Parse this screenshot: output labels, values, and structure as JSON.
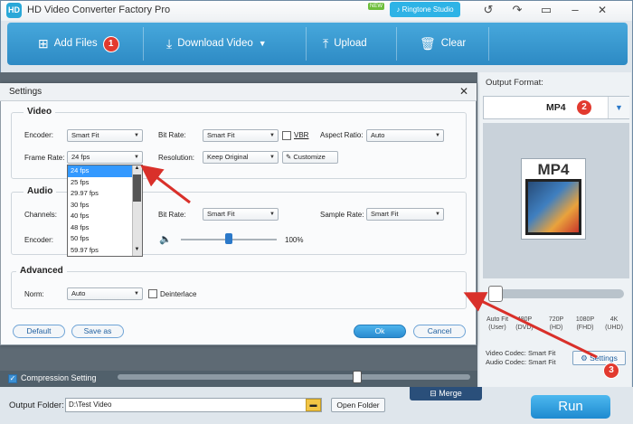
{
  "app": {
    "title": "HD Video Converter Factory Pro",
    "logo_text": "HD",
    "new_tag": "NEW",
    "ringtone_label": "Ringtone Studio"
  },
  "toolbar": {
    "add_files": "Add Files",
    "download_video": "Download Video",
    "upload": "Upload",
    "clear": "Clear"
  },
  "badges": {
    "one": "1",
    "two": "2",
    "three": "3"
  },
  "output_format": {
    "label": "Output Format:",
    "format": "MP4",
    "icon_text": "MP4"
  },
  "quality": {
    "labels": [
      "Auto Fit (User)",
      "480P (DVD)",
      "720P (HD)",
      "1080P (FHD)",
      "4K (UHD)"
    ]
  },
  "codec": {
    "video": "Video Codec: Smart Fit",
    "audio": "Audio Codec: Smart Fit"
  },
  "settings_button": "Settings",
  "dialog": {
    "title": "Settings",
    "video": {
      "group_title": "Video",
      "encoder_label": "Encoder:",
      "encoder_value": "Smart Fit",
      "bitrate_label": "Bit Rate:",
      "bitrate_value": "Smart Fit",
      "vbr_label": "VBR",
      "aspect_label": "Aspect Ratio:",
      "aspect_value": "Auto",
      "framerate_label": "Frame Rate:",
      "framerate_value": "24 fps",
      "resolution_label": "Resolution:",
      "resolution_value": "Keep Original",
      "customize_label": "Customize"
    },
    "framerate_options": [
      "24 fps",
      "25 fps",
      "29.97 fps",
      "30 fps",
      "40 fps",
      "48 fps",
      "50 fps",
      "59.97 fps"
    ],
    "audio": {
      "group_title": "Audio",
      "channels_label": "Channels:",
      "bitrate_label": "Bit Rate:",
      "bitrate_value": "Smart Fit",
      "samplerate_label": "Sample Rate:",
      "samplerate_value": "Smart Fit",
      "encoder_label": "Encoder:",
      "volume_percent": "100%",
      "volume_level": 0.5
    },
    "advanced": {
      "group_title": "Advanced",
      "norm_label": "Norm:",
      "norm_value": "Auto",
      "deinterlace_label": "Deinterlace"
    },
    "buttons": {
      "default": "Default",
      "save_as": "Save as",
      "ok": "Ok",
      "cancel": "Cancel"
    }
  },
  "bottom": {
    "compression_label": "Compression Setting",
    "output_folder_label": "Output Folder:",
    "output_folder_value": "D:\\Test Video",
    "open_folder": "Open Folder",
    "merge": "Merge",
    "run": "Run"
  },
  "colors": {
    "accent": "#2d8ac4",
    "badge": "#e23a2f",
    "arrow": "#d9302a"
  }
}
